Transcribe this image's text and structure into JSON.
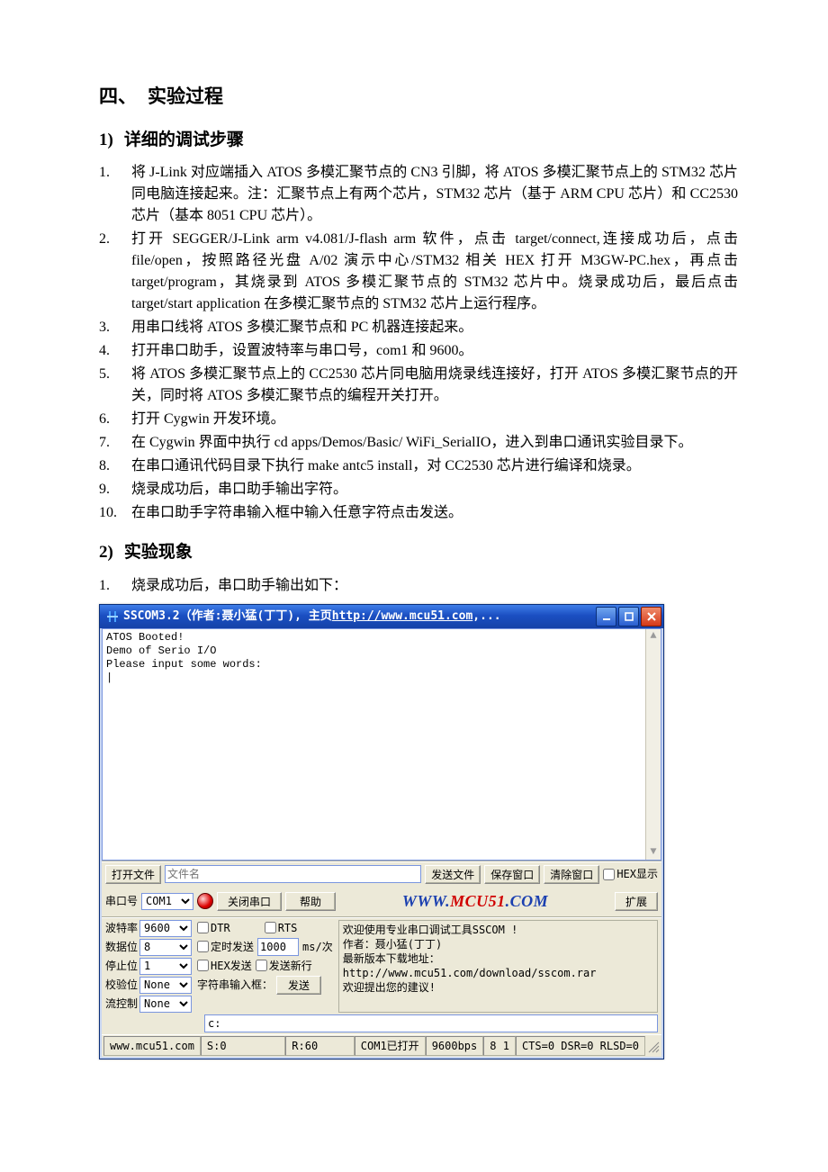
{
  "doc": {
    "h2": {
      "num": "四、",
      "title": "实验过程"
    },
    "s1": {
      "num": "1)",
      "title": "详细的调试步骤"
    },
    "s1_items": [
      "将 J-Link 对应端插入 ATOS 多模汇聚节点的 CN3 引脚，将 ATOS 多模汇聚节点上的 STM32 芯片同电脑连接起来。注：汇聚节点上有两个芯片，STM32 芯片（基于 ARM CPU 芯片）和 CC2530 芯片（基本 8051 CPU 芯片）。",
      "打开 SEGGER/J-Link arm v4.081/J-flash arm 软件，点击 target/connect,连接成功后，点击 file/open，按照路径光盘 A/02 演示中心/STM32 相关 HEX 打开 M3GW-PC.hex，再点击 target/program，其烧录到 ATOS 多模汇聚节点的 STM32 芯片中。烧录成功后，最后点击 target/start application 在多模汇聚节点的 STM32 芯片上运行程序。",
      "用串口线将 ATOS 多模汇聚节点和 PC 机器连接起来。",
      "打开串口助手，设置波特率与串口号，com1 和 9600。",
      "将 ATOS 多模汇聚节点上的 CC2530 芯片同电脑用烧录线连接好，打开 ATOS 多模汇聚节点的开关，同时将 ATOS 多模汇聚节点的编程开关打开。",
      "打开 Cygwin 开发环境。",
      "在 Cygwin 界面中执行 cd apps/Demos/Basic/ WiFi_SerialIO，进入到串口通讯实验目录下。",
      "在串口通讯代码目录下执行 make antc5 install，对 CC2530 芯片进行编译和烧录。",
      "烧录成功后，串口助手输出字符。",
      "在串口助手字符串输入框中输入任意字符点击发送。"
    ],
    "s2": {
      "num": "2)",
      "title": "实验现象"
    },
    "s2_items": [
      "烧录成功后，串口助手输出如下："
    ]
  },
  "sscom": {
    "title_prefix": "SSCOM3.2（作者:聂小猛(丁丁), 主页",
    "title_url": "http://www.mcu51.com",
    "title_suffix": ",...",
    "output": "ATOS Booted!\nDemo of Serio I/O\nPlease input some words:\n|",
    "btn_open_file": "打开文件",
    "lbl_file_name": "文件名",
    "btn_send_file": "发送文件",
    "btn_save_window": "保存窗口",
    "btn_clear_window": "清除窗口",
    "chk_hex_show": "HEX显示",
    "lbl_com": "串口号",
    "com_value": "COM1",
    "btn_close_com": "关闭串口",
    "btn_help": "帮助",
    "brand_www": "WWW.",
    "brand_mcu": "MCU51",
    "brand_com": ".COM",
    "btn_extend": "扩展",
    "lbl_baud": "波特率",
    "baud_value": "9600",
    "lbl_databits": "数据位",
    "databits_value": "8",
    "lbl_stopbits": "停止位",
    "stopbits_value": "1",
    "lbl_parity": "校验位",
    "parity_value": "None",
    "lbl_flow": "流控制",
    "flow_value": "None",
    "chk_dtr": "DTR",
    "chk_rts": "RTS",
    "chk_timed": "定时发送",
    "timed_value": "1000",
    "timed_unit": "ms/次",
    "chk_hex_send": "HEX发送",
    "chk_send_newline": "发送新行",
    "lbl_charbox": "字符串输入框：",
    "btn_send": "发送",
    "char_value": "c:",
    "info_line1": "欢迎使用专业串口调试工具SSCOM !",
    "info_line2": "作者：聂小猛(丁丁)",
    "info_line3": "最新版本下载地址：",
    "info_line4": "http://www.mcu51.com/download/sscom.rar",
    "info_line5": "欢迎提出您的建议!",
    "status_site": "www.mcu51.com",
    "status_s": "S:0",
    "status_r": "R:60",
    "status_com": "COM1已打开",
    "status_baud": "9600bps",
    "status_fmt": "8 1",
    "status_lines": "CTS=0 DSR=0 RLSD=0"
  }
}
